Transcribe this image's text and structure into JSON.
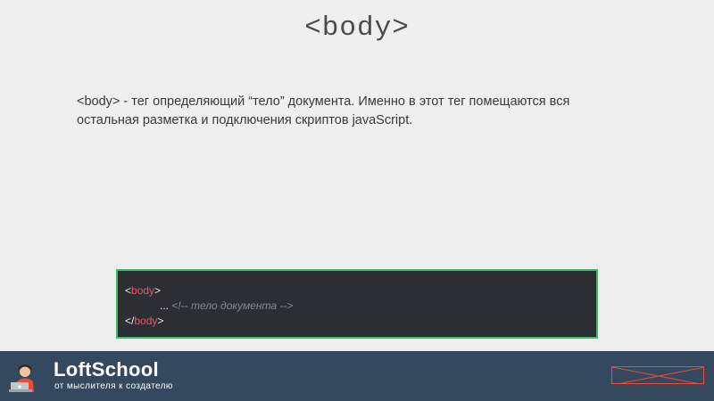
{
  "slide": {
    "title": "<body>",
    "description": "<body> - тег определяющий “тело” документа. Именно в этот тег помещаются вся остальная разметка и подключения скриптов javaScript."
  },
  "code": {
    "line1": {
      "open": "<",
      "tag": "body",
      "close": ">"
    },
    "line2": {
      "dots": "... ",
      "comment": "<!-- тело документа -->"
    },
    "line3": {
      "open": "</",
      "tag": "body",
      "close": ">"
    }
  },
  "footer": {
    "brand_name": "LoftSchool",
    "tagline": "от мыслителя к создателю",
    "logo_icon": "developer-at-laptop-icon",
    "nav_icon": "crossed-box-icon"
  },
  "colors": {
    "background": "#f0efef",
    "footer": "#34495e",
    "code_bg": "#2b2f34",
    "code_border": "#3dbb5e",
    "tag": "#f0506e",
    "accent_red": "#e74c3c"
  }
}
